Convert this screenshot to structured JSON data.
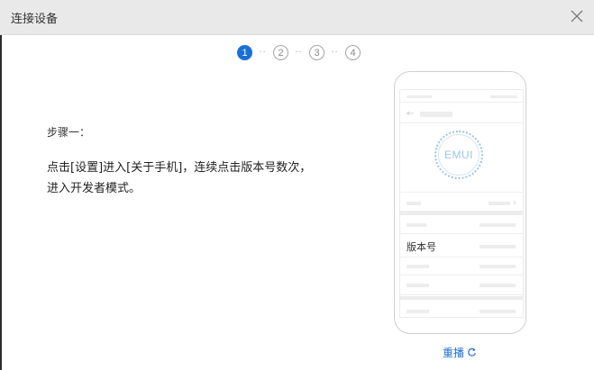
{
  "dialog": {
    "title": "连接设备"
  },
  "steps": {
    "items": [
      "1",
      "2",
      "3",
      "4"
    ],
    "active_index": 0,
    "separator": "··"
  },
  "instruction": {
    "heading": "步骤一：",
    "text": "点击[设置]进入[关于手机]，连续点击版本号数次，进入开发者模式。"
  },
  "phone": {
    "logo": "EMUI",
    "highlight_label": "版本号",
    "back_glyph": "←",
    "chevron_glyph": "›"
  },
  "replay": {
    "label": "重播",
    "icon": "refresh-icon"
  },
  "colors": {
    "accent": "#1a6fd6",
    "titlebar": "#e9e9e9",
    "logo": "#9ec4e4"
  }
}
